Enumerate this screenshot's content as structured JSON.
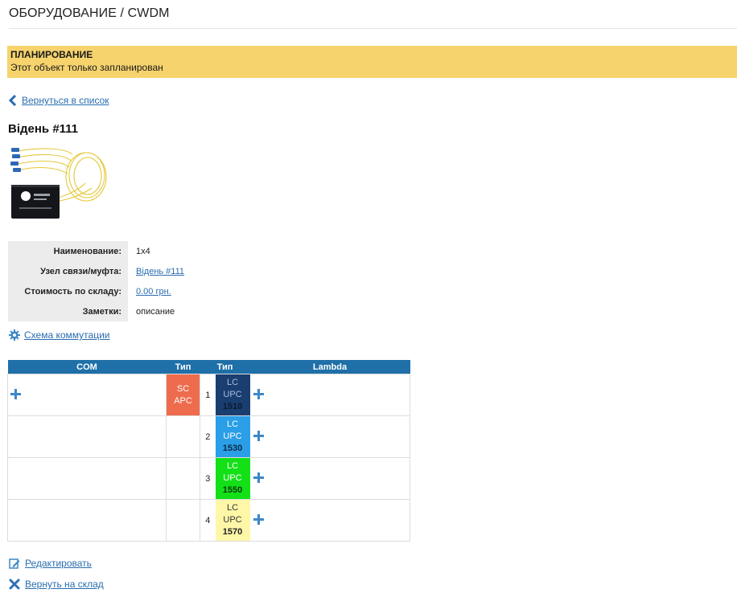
{
  "page": {
    "title": "ОБОРУДОВАНИЕ / CWDM"
  },
  "notice": {
    "title": "ПЛАНИРОВАНИЕ",
    "text": "Этот объект только запланирован",
    "color": "#f6d36d"
  },
  "back": {
    "label": "Вернуться в список",
    "icon": "chevron-left-icon"
  },
  "object": {
    "title": "Відень #111",
    "image": "cwdm-module-image"
  },
  "props": [
    {
      "key": "Наименование:",
      "value": "1x4",
      "link": false
    },
    {
      "key": "Узел связи/муфта:",
      "value": "Відень #111",
      "link": true
    },
    {
      "key": "Стоимость по складу:",
      "value": "0.00 грн.",
      "link": true
    },
    {
      "key": "Заметки:",
      "value": "описание",
      "link": false
    }
  ],
  "schema": {
    "label": "Схема коммутации",
    "icon": "gear-icon"
  },
  "ports_table": {
    "headers": [
      "COM",
      "Тип",
      "Тип",
      "Lambda"
    ],
    "com_connector": {
      "line1": "SC",
      "line2": "APC",
      "color": "#ee6c4d"
    },
    "rows": [
      {
        "num": "1",
        "line1": "LC",
        "line2": "UPC",
        "lambda": "1510",
        "bg": "#1a3e70",
        "fg": "#a8bedc",
        "lambda_color": "#0c1a30"
      },
      {
        "num": "2",
        "line1": "LC",
        "line2": "UPC",
        "lambda": "1530",
        "bg": "#2a9ee6",
        "fg": "#ffffff",
        "lambda_color": "#0d2a48"
      },
      {
        "num": "3",
        "line1": "LC",
        "line2": "UPC",
        "lambda": "1550",
        "bg": "#14e018",
        "fg": "#ffffff",
        "lambda_color": "#0a3a0a"
      },
      {
        "num": "4",
        "line1": "LC",
        "line2": "UPC",
        "lambda": "1570",
        "bg": "#fff7a8",
        "fg": "#333333",
        "lambda_color": "#222222"
      }
    ]
  },
  "actions": {
    "edit": {
      "label": "Редактировать",
      "icon": "edit-icon"
    },
    "return": {
      "label": "Вернуть на склад",
      "icon": "close-icon"
    }
  },
  "colors": {
    "link": "#2a6db0",
    "header": "#1f6fa8",
    "plus": "#3d87c8"
  }
}
